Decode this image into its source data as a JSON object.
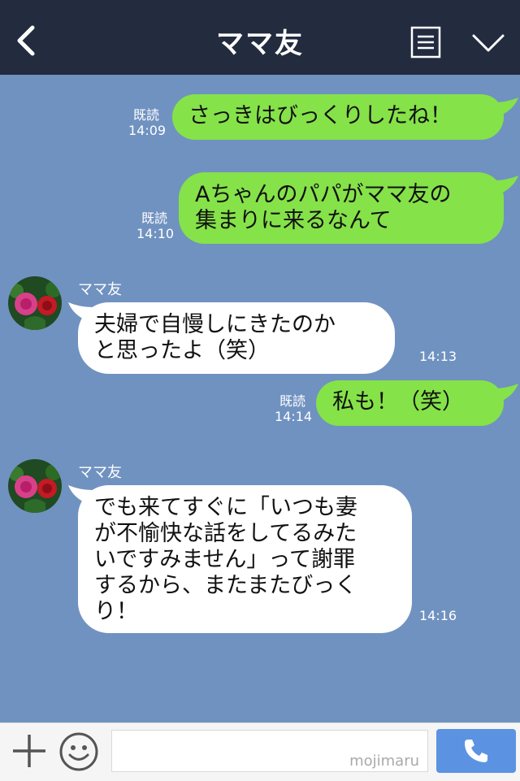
{
  "header": {
    "title": "ママ友",
    "icons": {
      "back": "chevron-left-icon",
      "menu": "notes-icon",
      "dropdown": "chevron-down-icon"
    }
  },
  "messages": [
    {
      "direction": "out",
      "read": "既読",
      "time": "14:09",
      "lines": [
        "さっきはびっくりしたね！"
      ]
    },
    {
      "direction": "out",
      "read": "既読",
      "time": "14:10",
      "lines": [
        "Aちゃんのパパがママ友の",
        "集まりに来るなんて"
      ]
    },
    {
      "direction": "in",
      "sender": "ママ友",
      "time": "14:13",
      "lines": [
        "夫婦で自慢しにきたのか",
        "と思ったよ（笑）"
      ]
    },
    {
      "direction": "out",
      "read": "既読",
      "time": "14:14",
      "lines": [
        "私も！（笑）"
      ]
    },
    {
      "direction": "in",
      "sender": "ママ友",
      "time": "14:16",
      "lines": [
        "でも来てすぐに「いつも妻",
        "が不愉快な話をしてるみた",
        "いですみません」って謝罪",
        "するから、またまたびっく",
        "り！"
      ]
    }
  ],
  "footer": {
    "watermark": "mojimaru",
    "icons": {
      "add": "plus-icon",
      "emoji": "smiley-icon",
      "call": "phone-icon"
    }
  },
  "colors": {
    "header": "#232b3f",
    "chat_background": "#7092c0",
    "outgoing_bubble": "#85e249",
    "incoming_bubble": "#ffffff",
    "call_button": "#5b93e2"
  }
}
